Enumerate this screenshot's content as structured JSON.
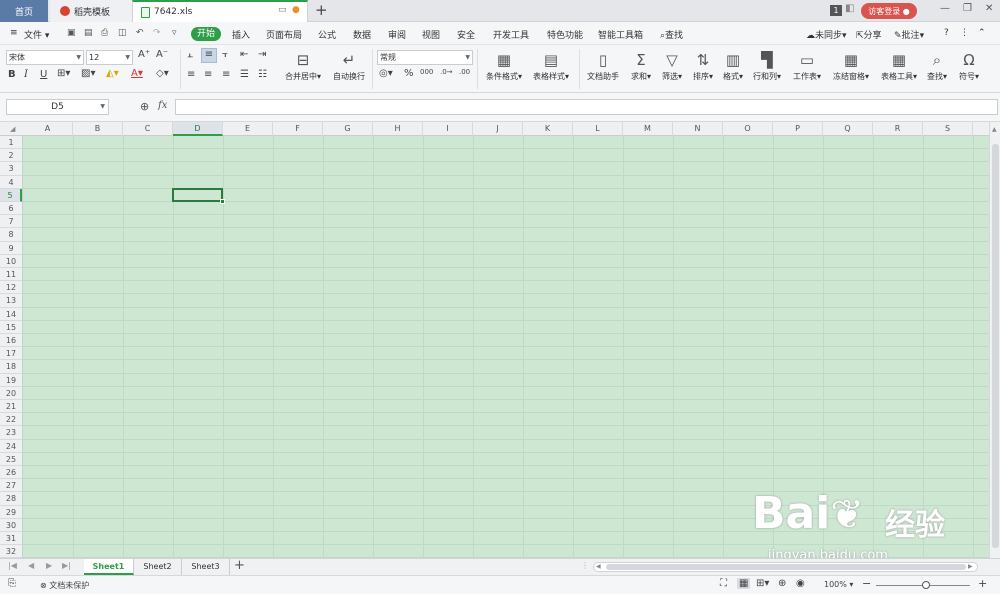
{
  "colors": {
    "accent": "#2e9e47",
    "login": "#d9534f",
    "grid_bg": "#cde7d3"
  },
  "tabs": {
    "home": "首页",
    "template": "稻壳模板",
    "file": "7642.xls"
  },
  "titlebar": {
    "badge": "1",
    "login": "访客登录"
  },
  "menu": {
    "file": "文件",
    "items": [
      "开始",
      "插入",
      "页面布局",
      "公式",
      "数据",
      "审阅",
      "视图",
      "安全",
      "开发工具",
      "特色功能",
      "智能工具箱"
    ],
    "search": "查找",
    "sync": "未同步",
    "share": "分享",
    "comment": "批注"
  },
  "ribbon": {
    "font_name": "宋体",
    "font_size": "12",
    "number_format": "常规",
    "merge_center": "合并居中",
    "wrap": "自动换行",
    "big_buttons": [
      "条件格式",
      "表格样式",
      "文档助手",
      "求和",
      "筛选",
      "排序",
      "格式",
      "行和列",
      "工作表",
      "冻结窗格",
      "表格工具",
      "查找",
      "符号"
    ]
  },
  "formula": {
    "cell_ref": "D5",
    "fx": "fx",
    "content": ""
  },
  "grid": {
    "columns": [
      "A",
      "B",
      "C",
      "D",
      "E",
      "F",
      "G",
      "H",
      "I",
      "J",
      "K",
      "L",
      "M",
      "N",
      "O",
      "P",
      "Q",
      "R",
      "S"
    ],
    "rows": [
      "1",
      "2",
      "3",
      "4",
      "5",
      "6",
      "7",
      "8",
      "9",
      "10",
      "11",
      "12",
      "13",
      "14",
      "15",
      "16",
      "17",
      "18",
      "19",
      "20",
      "21",
      "22",
      "23",
      "24",
      "25",
      "26",
      "27",
      "28",
      "29",
      "30",
      "31",
      "32"
    ],
    "selected_col": "D",
    "selected_row": "5"
  },
  "sheets": [
    "Sheet1",
    "Sheet2",
    "Sheet3"
  ],
  "active_sheet": "Sheet1",
  "status": {
    "protect": "文档未保护",
    "zoom": "100%"
  },
  "watermark": {
    "brand": "Bai",
    "brand2": "经验",
    "url": "jingyan.baidu.com"
  }
}
